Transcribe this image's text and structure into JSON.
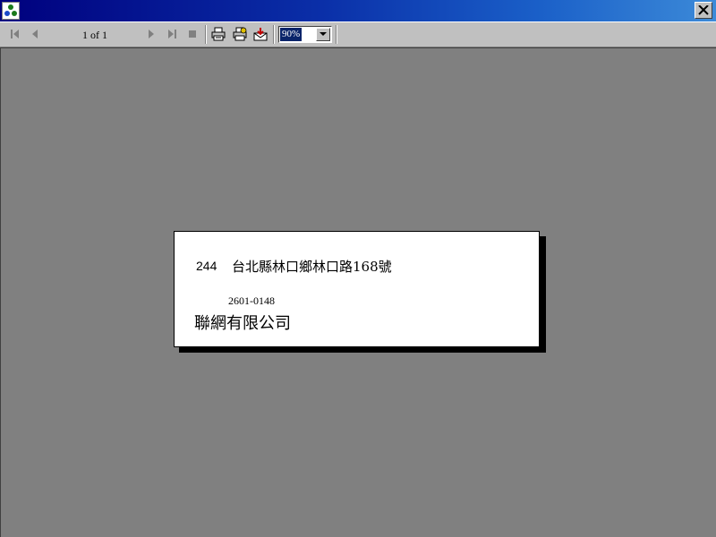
{
  "toolbar": {
    "page_indicator": "1 of 1",
    "zoom": {
      "selected": "90%"
    }
  },
  "document": {
    "postcode": "244",
    "address": "台北縣林口鄉林口路168號",
    "phone": "2601-0148",
    "company": "聯網有限公司"
  },
  "colors": {
    "title_bar_start": "#00007e",
    "title_bar_end": "#3c8ad8",
    "viewport_background": "#808080",
    "chrome": "#c0c0c0",
    "selection": "#0a246a"
  },
  "icons": {
    "app": "app-icon",
    "close": "close-icon",
    "first_page": "first-page-icon",
    "previous_page": "previous-page-icon",
    "next_page": "next-page-icon",
    "last_page": "last-page-icon",
    "stop": "stop-icon",
    "print": "printer-icon",
    "print_setup": "print-setup-icon",
    "export": "export-icon",
    "dropdown": "chevron-down-icon"
  }
}
